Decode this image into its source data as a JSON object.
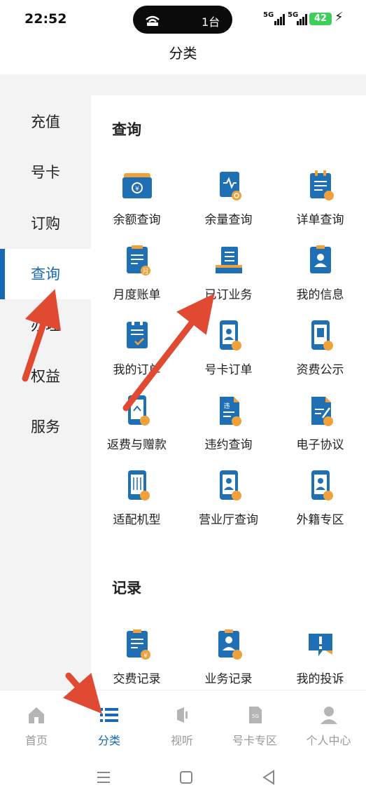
{
  "status": {
    "time": "22:52",
    "hotspot_devices": "1台",
    "signal1": "5G",
    "signal2": "5G",
    "battery": "42"
  },
  "header": {
    "title": "分类"
  },
  "sidebar": {
    "items": [
      {
        "label": "充值"
      },
      {
        "label": "号卡"
      },
      {
        "label": "订购"
      },
      {
        "label": "查询"
      },
      {
        "label": "办理"
      },
      {
        "label": "权益"
      },
      {
        "label": "服务"
      }
    ],
    "active_index": 3
  },
  "sections": [
    {
      "title": "查询",
      "items": [
        {
          "label": "余额查询",
          "icon": "wallet-icon"
        },
        {
          "label": "余量查询",
          "icon": "usage-doc-icon"
        },
        {
          "label": "详单查询",
          "icon": "list-clipboard-icon"
        },
        {
          "label": "月度账单",
          "icon": "monthly-bill-icon"
        },
        {
          "label": "已订业务",
          "icon": "subscribed-list-icon"
        },
        {
          "label": "我的信息",
          "icon": "profile-card-icon"
        },
        {
          "label": "我的订单",
          "icon": "order-check-icon"
        },
        {
          "label": "号卡订单",
          "icon": "phone-user-icon"
        },
        {
          "label": "资费公示",
          "icon": "phone-doc-icon"
        },
        {
          "label": "返费与赠款",
          "icon": "refund-phone-icon"
        },
        {
          "label": "违约查询",
          "icon": "violation-doc-icon"
        },
        {
          "label": "电子协议",
          "icon": "edit-doc-icon"
        },
        {
          "label": "适配机型",
          "icon": "phone-sliders-icon"
        },
        {
          "label": "营业厅查询",
          "icon": "store-location-icon"
        },
        {
          "label": "外籍专区",
          "icon": "foreign-zone-icon"
        }
      ]
    },
    {
      "title": "记录",
      "items": [
        {
          "label": "交费记录",
          "icon": "payment-record-icon"
        },
        {
          "label": "业务记录",
          "icon": "service-record-icon"
        },
        {
          "label": "我的投诉",
          "icon": "complaint-icon"
        }
      ]
    }
  ],
  "tabbar": {
    "items": [
      {
        "label": "首页",
        "icon": "home-icon"
      },
      {
        "label": "分类",
        "icon": "category-icon"
      },
      {
        "label": "视听",
        "icon": "media-icon"
      },
      {
        "label": "号卡专区",
        "icon": "sim-card-icon"
      },
      {
        "label": "个人中心",
        "icon": "person-icon"
      }
    ],
    "active_index": 1
  },
  "colors": {
    "accent": "#1769b3",
    "icon_blue": "#1f6fb5",
    "icon_orange": "#f0a13b",
    "arrow_red": "#e04a33"
  }
}
